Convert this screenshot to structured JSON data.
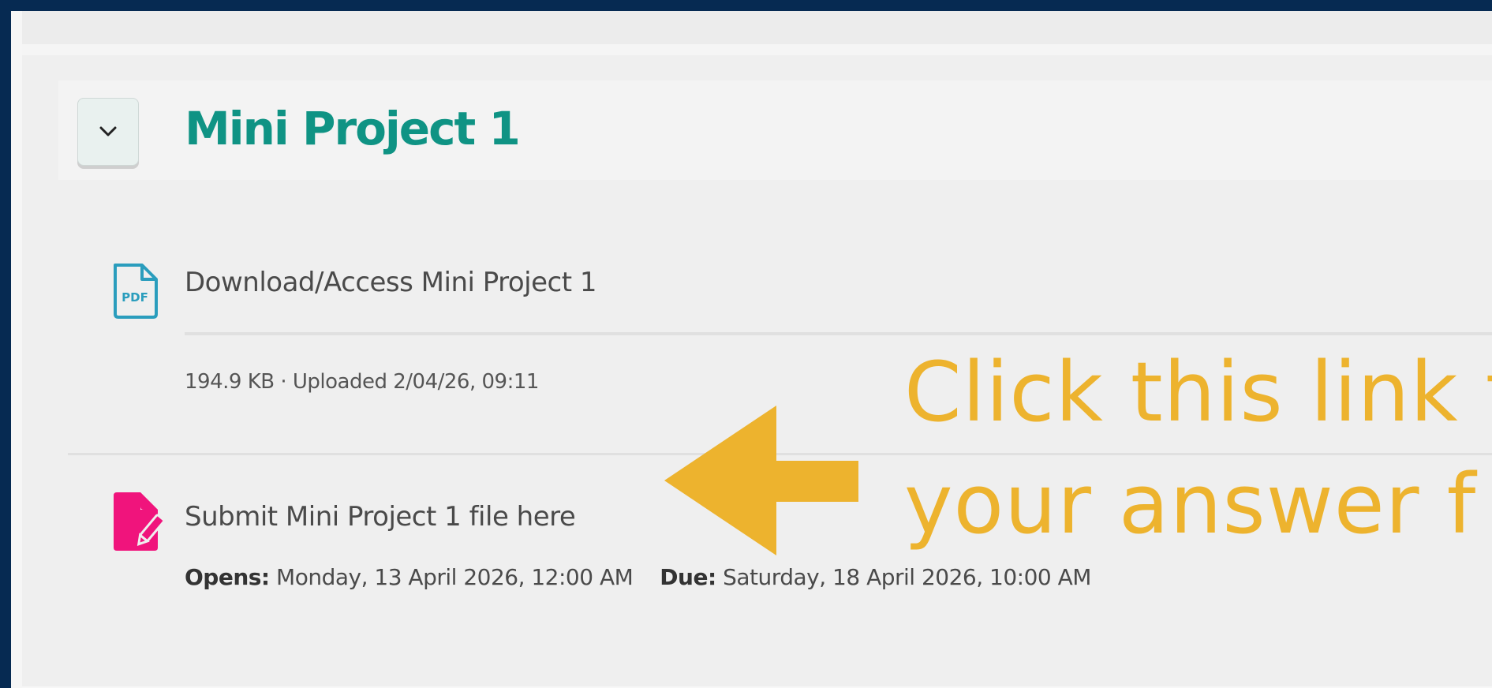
{
  "section": {
    "title": "Mini Project 1",
    "collapse_icon": "chevron-down-icon"
  },
  "activities": [
    {
      "icon": "pdf-file-icon",
      "title": "Download/Access Mini Project 1",
      "meta": "194.9 KB · Uploaded 2/04/26, 09:11"
    },
    {
      "icon": "assignment-edit-icon",
      "title": "Submit Mini Project 1 file here",
      "opens_label": "Opens:",
      "opens_value": "Monday, 13 April 2026, 12:00 AM",
      "due_label": "Due:",
      "due_value": "Saturday, 18 April 2026, 10:00 AM"
    }
  ],
  "annotation": {
    "line1": "Click this link t",
    "line2": "your answer f",
    "color": "#edb32e",
    "arrow_icon": "left-arrow-icon"
  },
  "colors": {
    "frame": "#062a52",
    "title": "#0f9384",
    "pdf_icon": "#2a9dbd",
    "assign_icon": "#f0147c"
  }
}
